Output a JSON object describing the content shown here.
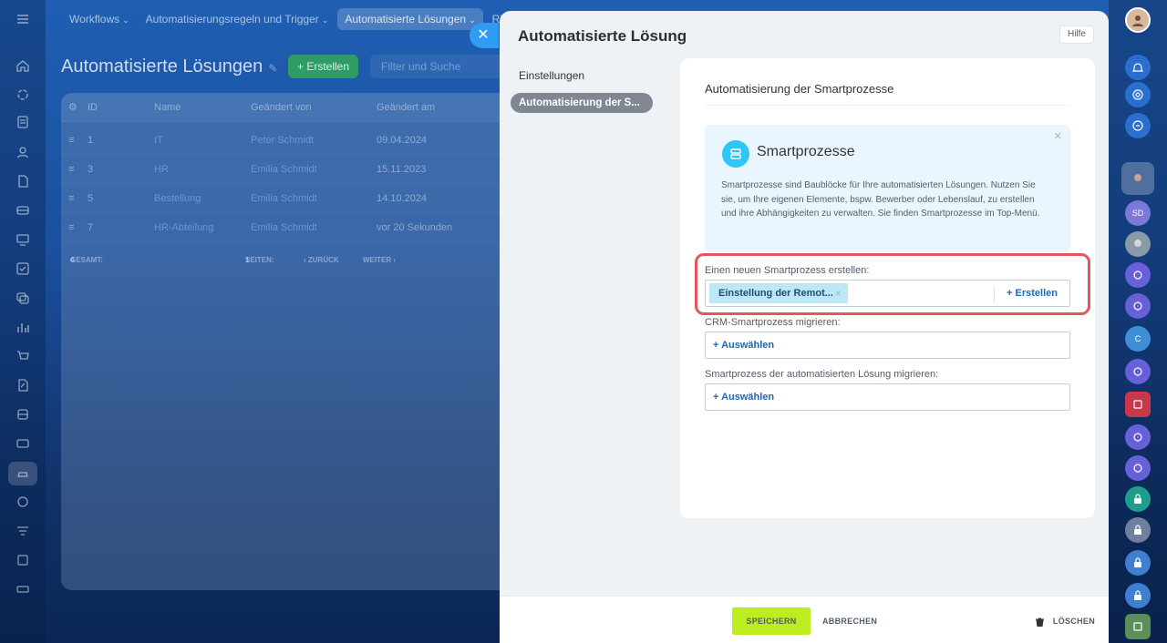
{
  "topnav": {
    "items": [
      {
        "label": "Workflows"
      },
      {
        "label": "Automatisierungsregeln und Trigger"
      },
      {
        "label": "Automatisierte Lösungen"
      },
      {
        "label": "RP"
      }
    ]
  },
  "background_page": {
    "title": "Automatisierte Lösungen",
    "create_label": "+ Erstellen",
    "filter_placeholder": "Filter und Suche",
    "columns": [
      "ID",
      "Name",
      "Geändert von",
      "Geändert am"
    ],
    "rows": [
      {
        "id": "1",
        "name": "IT",
        "by": "Peter Schmidt",
        "date": "09.04.2024"
      },
      {
        "id": "3",
        "name": "HR",
        "by": "Emilia Schmidt",
        "date": "15.11.2023"
      },
      {
        "id": "5",
        "name": "Bestellung",
        "by": "Emilia Schmidt",
        "date": "14.10.2024"
      },
      {
        "id": "7",
        "name": "HR-Abteilung",
        "by": "Emilia Schmidt",
        "date": "vor 20 Sekunden"
      }
    ],
    "footer": {
      "total_label": "GESAMT:",
      "total_value": "4",
      "pages_label": "SEITEN:",
      "pages_value": "1",
      "prev_label": "‹ ZURÜCK",
      "next_label": "WEITER ›"
    }
  },
  "panel": {
    "title": "Automatisierte Lösung",
    "help_label": "Hilfe",
    "menu": [
      {
        "label": "Einstellungen",
        "active": false
      },
      {
        "label": "Automatisierung der S...",
        "active": true
      }
    ],
    "section_title": "Automatisierung der Smartprozesse",
    "info": {
      "icon": "smart-process-icon",
      "title": "Smartprozesse",
      "description": "Smartprozesse sind Baublöcke für Ihre automatisierten Lösungen. Nutzen Sie sie, um Ihre eigenen Elemente, bspw. Bewerber oder Lebenslauf, zu erstellen und ihre Abhängigkeiten zu verwalten. Sie finden Smartprozesse im Top-Menü."
    },
    "create_field": {
      "label": "Einen neuen Smartprozess erstellen:",
      "chip": "Einstellung der Remot...",
      "action": "+ Erstellen"
    },
    "crm_field": {
      "label": "CRM-Smartprozess migrieren:",
      "action": "+ Auswählen"
    },
    "solution_field": {
      "label": "Smartprozess der automatisierten Lösung migrieren:",
      "action": "+ Auswählen"
    },
    "footer": {
      "save": "SPEICHERN",
      "cancel": "ABBRECHEN",
      "delete": "LÖSCHEN"
    }
  },
  "right_rail": {
    "avatars": [
      {
        "initials": "SD",
        "color": "#7b78d8"
      },
      {
        "initials": "C",
        "color": "#3f8fd6"
      }
    ]
  },
  "colors": {
    "accent_blue": "#2f9bf4",
    "save_green": "#bbed21",
    "highlight_red": "#e2575a",
    "info_bg": "#eaf6fd"
  }
}
